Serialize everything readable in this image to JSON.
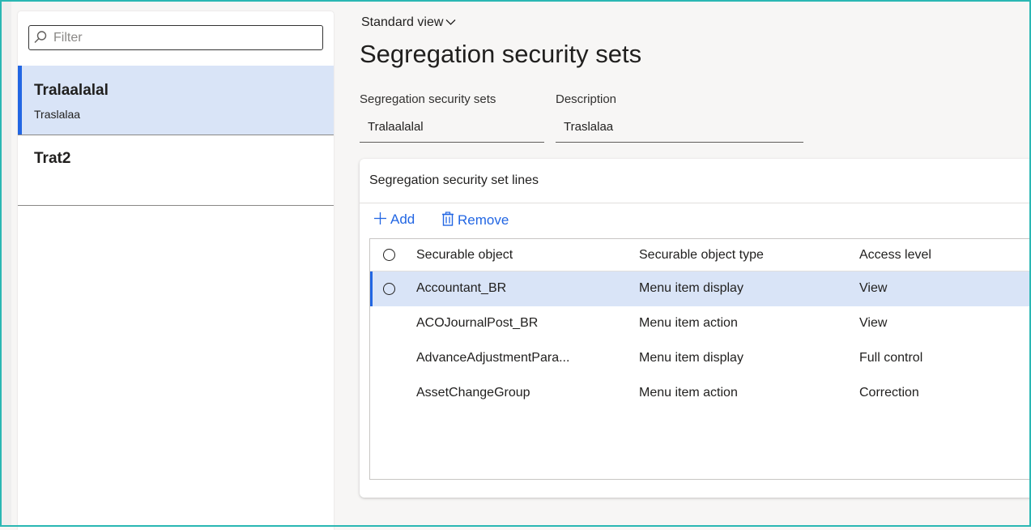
{
  "filter": {
    "placeholder": "Filter"
  },
  "list": {
    "items": [
      {
        "title": "Tralaalalal",
        "subtitle": "Traslalaa",
        "selected": true
      },
      {
        "title": "Trat2",
        "subtitle": "",
        "selected": false
      }
    ]
  },
  "header": {
    "view_label": "Standard view",
    "page_title": "Segregation security sets"
  },
  "fields": {
    "set_label": "Segregation security sets",
    "set_value": "Tralaalalal",
    "description_label": "Description",
    "description_value": "Traslalaa"
  },
  "lines": {
    "title": "Segregation security set lines",
    "add_label": "Add",
    "remove_label": "Remove",
    "columns": [
      "Securable object",
      "Securable object type",
      "Access level"
    ],
    "rows": [
      {
        "object": "Accountant_BR",
        "type": "Menu item display",
        "access": "View",
        "selected": true
      },
      {
        "object": "ACOJournalPost_BR",
        "type": "Menu item action",
        "access": "View",
        "selected": false
      },
      {
        "object": "AdvanceAdjustmentPara...",
        "type": "Menu item display",
        "access": "Full control",
        "selected": false
      },
      {
        "object": "AssetChangeGroup",
        "type": "Menu item action",
        "access": "Correction",
        "selected": false
      }
    ]
  },
  "colors": {
    "accent": "#2266e3",
    "selection": "#d9e4f7",
    "frame": "#2ab7b3"
  }
}
